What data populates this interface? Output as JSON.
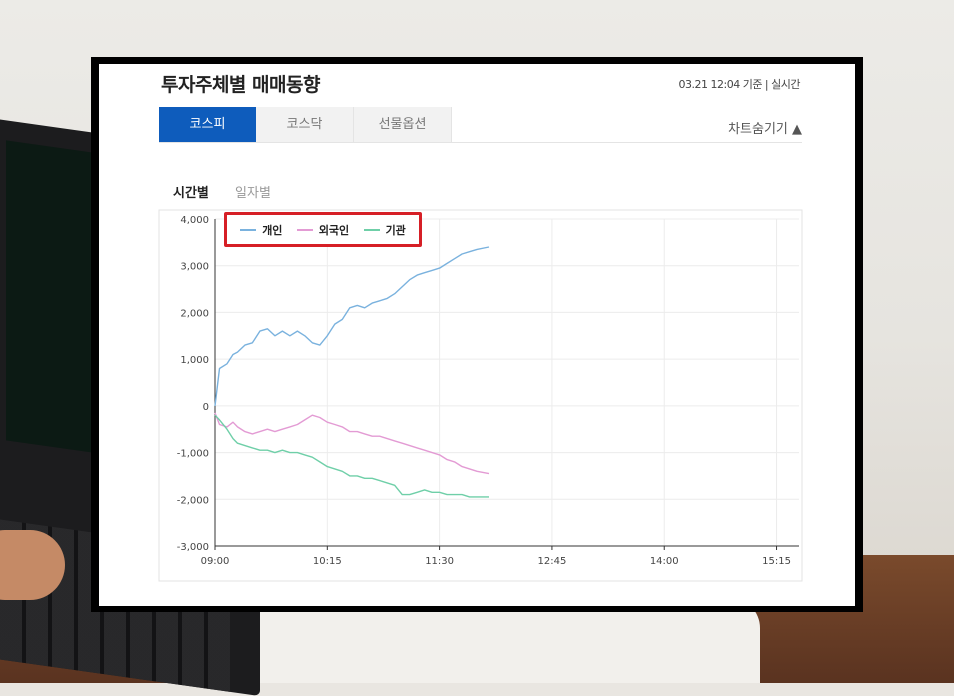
{
  "page": {
    "title": "투자주체별 매매동향",
    "timestamp": "03.21 12:04 기준 | 실시간",
    "tabs": [
      {
        "label": "코스피",
        "active": true
      },
      {
        "label": "코스닥",
        "active": false
      },
      {
        "label": "선물옵션",
        "active": false
      }
    ],
    "chart_toggle": "차트숨기기 ▲",
    "subtabs": [
      {
        "label": "시간별",
        "active": true
      },
      {
        "label": "일자별",
        "active": false
      }
    ],
    "accent_color": "#0e5cbc",
    "highlight_color": "#d61f26"
  },
  "chart_data": {
    "type": "line",
    "title": "",
    "xlabel": "",
    "ylabel": "",
    "x_ticks": [
      "09:00",
      "10:15",
      "11:30",
      "12:45",
      "14:00",
      "15:15"
    ],
    "y_ticks": [
      "4,000",
      "3,000",
      "2,000",
      "1,000",
      "0",
      "-1,000",
      "-2,000",
      "-3,000"
    ],
    "ylim": [
      -3000,
      4000
    ],
    "xlim": [
      "09:00",
      "15:30"
    ],
    "grid": true,
    "legend_placement": "top-left",
    "series": [
      {
        "name": "개인",
        "color": "#7ab2de",
        "points": [
          [
            "09:00",
            0
          ],
          [
            "09:03",
            800
          ],
          [
            "09:08",
            900
          ],
          [
            "09:12",
            1100
          ],
          [
            "09:15",
            1150
          ],
          [
            "09:20",
            1300
          ],
          [
            "09:25",
            1350
          ],
          [
            "09:30",
            1600
          ],
          [
            "09:35",
            1650
          ],
          [
            "09:40",
            1500
          ],
          [
            "09:45",
            1600
          ],
          [
            "09:50",
            1500
          ],
          [
            "09:55",
            1600
          ],
          [
            "10:00",
            1500
          ],
          [
            "10:05",
            1350
          ],
          [
            "10:10",
            1300
          ],
          [
            "10:15",
            1500
          ],
          [
            "10:20",
            1750
          ],
          [
            "10:25",
            1850
          ],
          [
            "10:30",
            2100
          ],
          [
            "10:35",
            2150
          ],
          [
            "10:40",
            2100
          ],
          [
            "10:45",
            2200
          ],
          [
            "10:50",
            2250
          ],
          [
            "10:55",
            2300
          ],
          [
            "11:00",
            2400
          ],
          [
            "11:05",
            2550
          ],
          [
            "11:10",
            2700
          ],
          [
            "11:15",
            2800
          ],
          [
            "11:20",
            2850
          ],
          [
            "11:25",
            2900
          ],
          [
            "11:30",
            2950
          ],
          [
            "11:35",
            3050
          ],
          [
            "11:40",
            3150
          ],
          [
            "11:45",
            3250
          ],
          [
            "11:50",
            3300
          ],
          [
            "11:55",
            3350
          ],
          [
            "12:03",
            3400
          ]
        ]
      },
      {
        "name": "외국인",
        "color": "#e39bd4",
        "points": [
          [
            "09:00",
            -150
          ],
          [
            "09:03",
            -400
          ],
          [
            "09:08",
            -450
          ],
          [
            "09:12",
            -350
          ],
          [
            "09:15",
            -450
          ],
          [
            "09:20",
            -550
          ],
          [
            "09:25",
            -600
          ],
          [
            "09:30",
            -550
          ],
          [
            "09:35",
            -500
          ],
          [
            "09:40",
            -550
          ],
          [
            "09:45",
            -500
          ],
          [
            "09:50",
            -450
          ],
          [
            "09:55",
            -400
          ],
          [
            "10:00",
            -300
          ],
          [
            "10:05",
            -200
          ],
          [
            "10:10",
            -250
          ],
          [
            "10:15",
            -350
          ],
          [
            "10:20",
            -400
          ],
          [
            "10:25",
            -450
          ],
          [
            "10:30",
            -550
          ],
          [
            "10:35",
            -550
          ],
          [
            "10:40",
            -600
          ],
          [
            "10:45",
            -650
          ],
          [
            "10:50",
            -650
          ],
          [
            "10:55",
            -700
          ],
          [
            "11:00",
            -750
          ],
          [
            "11:05",
            -800
          ],
          [
            "11:10",
            -850
          ],
          [
            "11:15",
            -900
          ],
          [
            "11:20",
            -950
          ],
          [
            "11:25",
            -1000
          ],
          [
            "11:30",
            -1050
          ],
          [
            "11:35",
            -1150
          ],
          [
            "11:40",
            -1200
          ],
          [
            "11:45",
            -1300
          ],
          [
            "11:50",
            -1350
          ],
          [
            "11:55",
            -1400
          ],
          [
            "12:03",
            -1450
          ]
        ]
      },
      {
        "name": "기관",
        "color": "#6fcfa8",
        "points": [
          [
            "09:00",
            -200
          ],
          [
            "09:03",
            -300
          ],
          [
            "09:08",
            -500
          ],
          [
            "09:12",
            -700
          ],
          [
            "09:15",
            -800
          ],
          [
            "09:20",
            -850
          ],
          [
            "09:25",
            -900
          ],
          [
            "09:30",
            -950
          ],
          [
            "09:35",
            -950
          ],
          [
            "09:40",
            -1000
          ],
          [
            "09:45",
            -950
          ],
          [
            "09:50",
            -1000
          ],
          [
            "09:55",
            -1000
          ],
          [
            "10:00",
            -1050
          ],
          [
            "10:05",
            -1100
          ],
          [
            "10:10",
            -1200
          ],
          [
            "10:15",
            -1300
          ],
          [
            "10:20",
            -1350
          ],
          [
            "10:25",
            -1400
          ],
          [
            "10:30",
            -1500
          ],
          [
            "10:35",
            -1500
          ],
          [
            "10:40",
            -1550
          ],
          [
            "10:45",
            -1550
          ],
          [
            "10:50",
            -1600
          ],
          [
            "10:55",
            -1650
          ],
          [
            "11:00",
            -1700
          ],
          [
            "11:05",
            -1900
          ],
          [
            "11:10",
            -1900
          ],
          [
            "11:15",
            -1850
          ],
          [
            "11:20",
            -1800
          ],
          [
            "11:25",
            -1850
          ],
          [
            "11:30",
            -1850
          ],
          [
            "11:35",
            -1900
          ],
          [
            "11:40",
            -1900
          ],
          [
            "11:45",
            -1900
          ],
          [
            "11:50",
            -1950
          ],
          [
            "11:55",
            -1950
          ],
          [
            "12:03",
            -1950
          ]
        ]
      }
    ]
  }
}
